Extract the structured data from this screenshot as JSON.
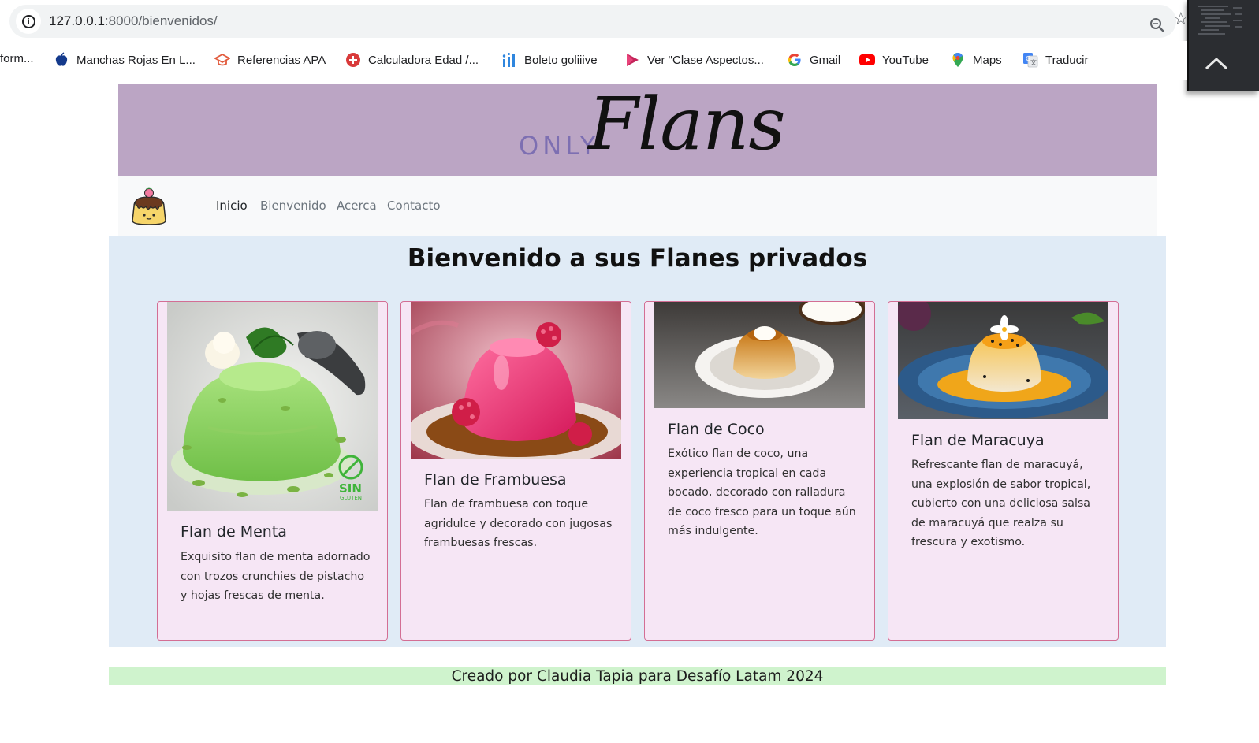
{
  "browser": {
    "url_host": "127.0.0.1",
    "url_rest": ":8000/bienvenidos/",
    "bookmarks": [
      {
        "label": "form...",
        "icon": "none"
      },
      {
        "label": "Manchas Rojas En L...",
        "icon": "apple-icon"
      },
      {
        "label": "Referencias APA",
        "icon": "graduation-cap-icon"
      },
      {
        "label": "Calculadora Edad /...",
        "icon": "plus-circle-icon"
      },
      {
        "label": "Boleto goliiive",
        "icon": "bars-icon"
      },
      {
        "label": "Ver \"Clase Aspectos...",
        "icon": "play-icon"
      },
      {
        "label": "Gmail",
        "icon": "google-g-icon"
      },
      {
        "label": "YouTube",
        "icon": "youtube-icon"
      },
      {
        "label": "Maps",
        "icon": "map-pin-icon"
      },
      {
        "label": "Traducir",
        "icon": "translate-icon"
      }
    ]
  },
  "header": {
    "logo_small": "ONLY",
    "logo_large": "Flans",
    "banner_color": "#bba5c4"
  },
  "nav": {
    "links": [
      {
        "label": "Inicio",
        "active": true
      },
      {
        "label": "Bienvenido",
        "active": false
      },
      {
        "label": "Acerca",
        "active": false
      },
      {
        "label": "Contacto",
        "active": false
      }
    ]
  },
  "main": {
    "title": "Bienvenido a sus Flanes privados",
    "background": "#e0ebf6",
    "cards": [
      {
        "title": "Flan de Menta",
        "text": "Exquisito flan de menta adornado con trozos crunchies de pistacho y hojas frescas de menta.",
        "image": "green-mint-flan-image",
        "badge": "SIN",
        "badge_sub": "GLUTEN"
      },
      {
        "title": "Flan de Frambuesa",
        "text": "Flan de frambuesa con toque agridulce y decorado con jugosas frambuesas frescas.",
        "image": "pink-raspberry-flan-image"
      },
      {
        "title": "Flan de Coco",
        "text": "Exótico flan de coco, una experiencia tropical en cada bocado, decorado con ralladura de coco fresco para un toque aún más indulgente.",
        "image": "coconut-flan-image"
      },
      {
        "title": "Flan de Maracuya",
        "text": "Refrescante flan de maracuyá, una explosión de sabor tropical, cubierto con una deliciosa salsa de maracuyá que realza su frescura y exotismo.",
        "image": "passion-fruit-flan-image"
      }
    ]
  },
  "footer": {
    "text": "Creado por Claudia Tapia para Desafío Latam 2024",
    "background": "#cff3cd"
  }
}
